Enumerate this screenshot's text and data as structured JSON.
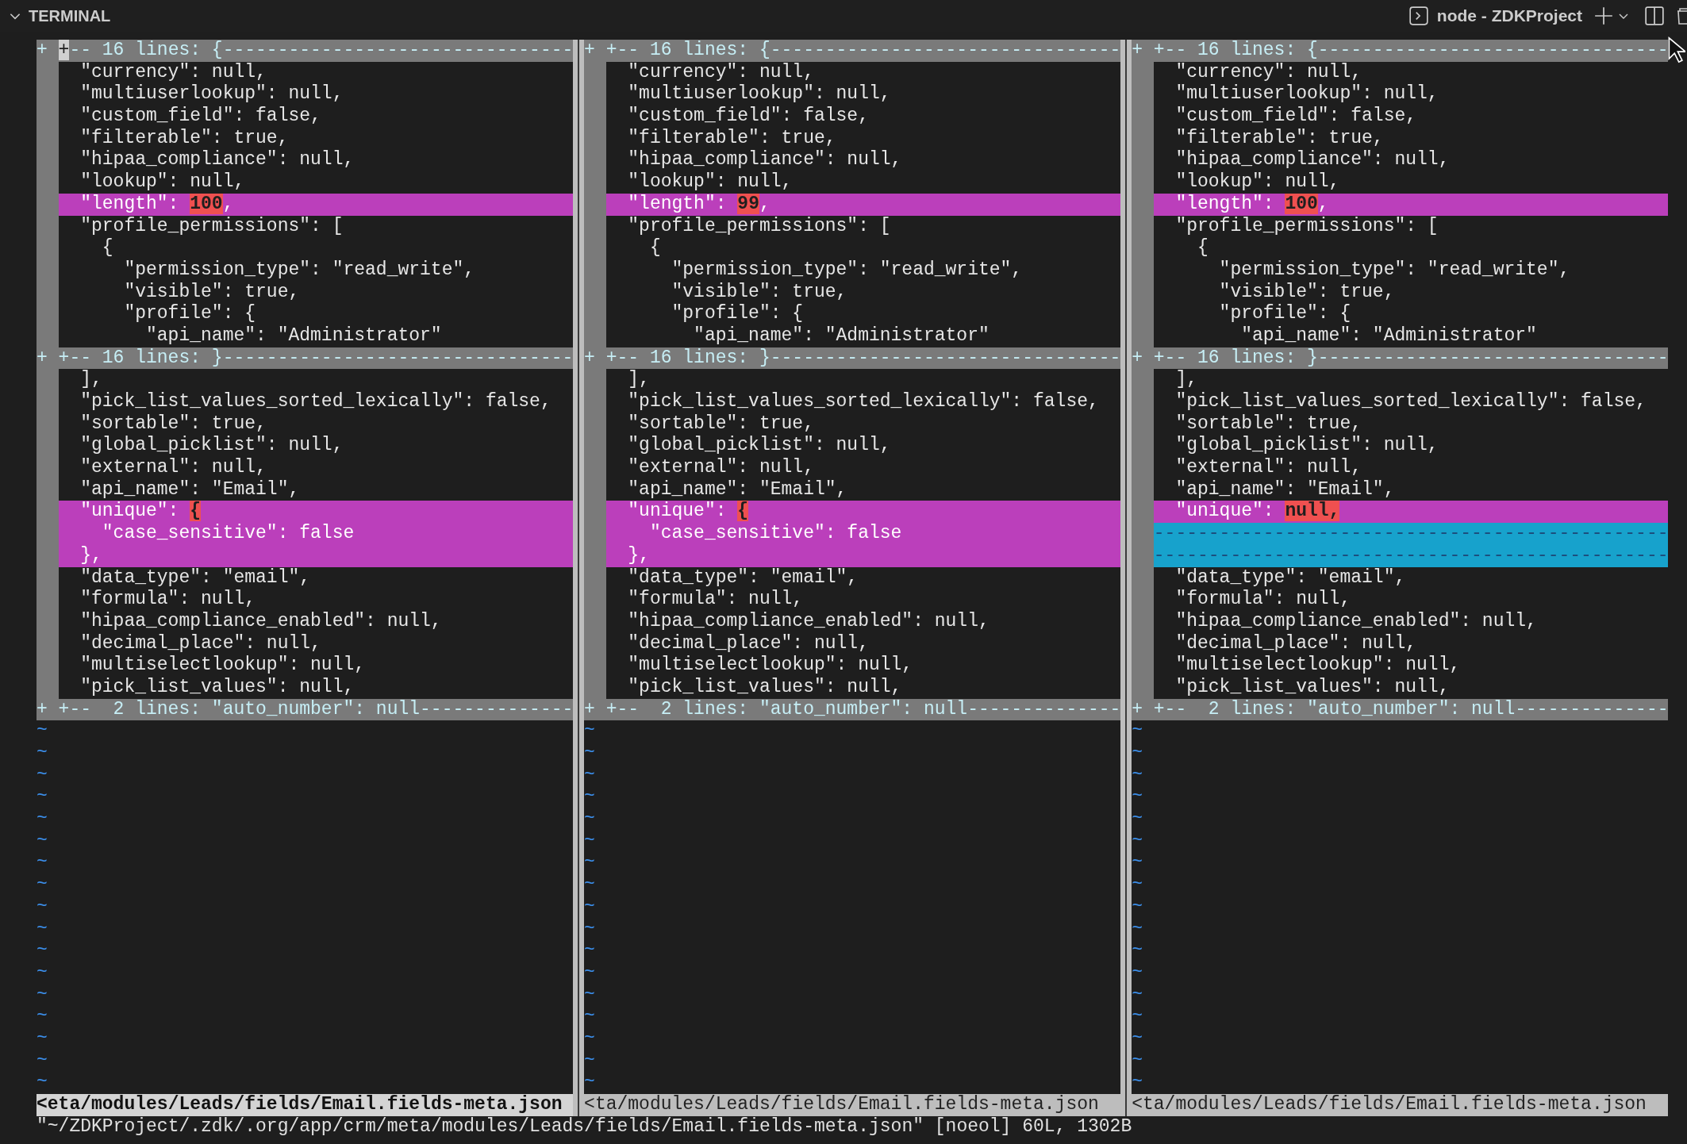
{
  "panel": {
    "title": "TERMINAL",
    "terminal_name": "node - ZDKProject"
  },
  "panes": [
    {
      "current": true,
      "status": "<eta/modules/Leads/fields/Email.fields-meta.json",
      "lines": [
        {
          "kind": "fold",
          "marker": "+",
          "text": "+-- 16 lines: {--------------------------------",
          "cursor": true
        },
        {
          "kind": "text",
          "text": "  \"currency\": null,"
        },
        {
          "kind": "text",
          "text": "  \"multiuserlookup\": null,"
        },
        {
          "kind": "text",
          "text": "  \"custom_field\": false,"
        },
        {
          "kind": "text",
          "text": "  \"filterable\": true,"
        },
        {
          "kind": "text",
          "text": "  \"hipaa_compliance\": null,"
        },
        {
          "kind": "text",
          "text": "  \"lookup\": null,"
        },
        {
          "kind": "changed",
          "text": "  \"length\": ",
          "highlight": "100",
          "after": ","
        },
        {
          "kind": "text",
          "text": "  \"profile_permissions\": ["
        },
        {
          "kind": "text",
          "text": "    {"
        },
        {
          "kind": "text",
          "text": "      \"permission_type\": \"read_write\","
        },
        {
          "kind": "text",
          "text": "      \"visible\": true,"
        },
        {
          "kind": "text",
          "text": "      \"profile\": {"
        },
        {
          "kind": "text",
          "text": "        \"api_name\": \"Administrator\""
        },
        {
          "kind": "fold",
          "marker": "+",
          "text": "+-- 16 lines: }--------------------------------"
        },
        {
          "kind": "text",
          "text": "  ],"
        },
        {
          "kind": "text",
          "text": "  \"pick_list_values_sorted_lexically\": false,"
        },
        {
          "kind": "text",
          "text": "  \"sortable\": true,"
        },
        {
          "kind": "text",
          "text": "  \"global_picklist\": null,"
        },
        {
          "kind": "text",
          "text": "  \"external\": null,"
        },
        {
          "kind": "text",
          "text": "  \"api_name\": \"Email\","
        },
        {
          "kind": "changed",
          "text": "  \"unique\": ",
          "highlight": "{"
        },
        {
          "kind": "changed",
          "text": "    \"case_sensitive\": false"
        },
        {
          "kind": "changed",
          "text": "  },"
        },
        {
          "kind": "text",
          "text": "  \"data_type\": \"email\","
        },
        {
          "kind": "text",
          "text": "  \"formula\": null,"
        },
        {
          "kind": "text",
          "text": "  \"hipaa_compliance_enabled\": null,"
        },
        {
          "kind": "text",
          "text": "  \"decimal_place\": null,"
        },
        {
          "kind": "text",
          "text": "  \"multiselectlookup\": null,"
        },
        {
          "kind": "text",
          "text": "  \"pick_list_values\": null,"
        },
        {
          "kind": "fold",
          "marker": "+",
          "text": "+--  2 lines: \"auto_number\": null--------------"
        },
        {
          "kind": "tilde",
          "text": "~"
        },
        {
          "kind": "tilde",
          "text": "~"
        },
        {
          "kind": "tilde",
          "text": "~"
        },
        {
          "kind": "tilde",
          "text": "~"
        },
        {
          "kind": "tilde",
          "text": "~"
        },
        {
          "kind": "tilde",
          "text": "~"
        },
        {
          "kind": "tilde",
          "text": "~"
        },
        {
          "kind": "tilde",
          "text": "~"
        },
        {
          "kind": "tilde",
          "text": "~"
        },
        {
          "kind": "tilde",
          "text": "~"
        },
        {
          "kind": "tilde",
          "text": "~"
        },
        {
          "kind": "tilde",
          "text": "~"
        },
        {
          "kind": "tilde",
          "text": "~"
        },
        {
          "kind": "tilde",
          "text": "~"
        },
        {
          "kind": "tilde",
          "text": "~"
        },
        {
          "kind": "tilde",
          "text": "~"
        },
        {
          "kind": "tilde",
          "text": "~"
        }
      ]
    },
    {
      "current": false,
      "status": "<ta/modules/Leads/fields/Email.fields-meta.json",
      "lines": [
        {
          "kind": "fold",
          "marker": "+",
          "text": "+-- 16 lines: {--------------------------------"
        },
        {
          "kind": "text",
          "text": "  \"currency\": null,"
        },
        {
          "kind": "text",
          "text": "  \"multiuserlookup\": null,"
        },
        {
          "kind": "text",
          "text": "  \"custom_field\": false,"
        },
        {
          "kind": "text",
          "text": "  \"filterable\": true,"
        },
        {
          "kind": "text",
          "text": "  \"hipaa_compliance\": null,"
        },
        {
          "kind": "text",
          "text": "  \"lookup\": null,"
        },
        {
          "kind": "changed",
          "text": "  \"length\": ",
          "highlight": "99",
          "after": ","
        },
        {
          "kind": "text",
          "text": "  \"profile_permissions\": ["
        },
        {
          "kind": "text",
          "text": "    {"
        },
        {
          "kind": "text",
          "text": "      \"permission_type\": \"read_write\","
        },
        {
          "kind": "text",
          "text": "      \"visible\": true,"
        },
        {
          "kind": "text",
          "text": "      \"profile\": {"
        },
        {
          "kind": "text",
          "text": "        \"api_name\": \"Administrator\""
        },
        {
          "kind": "fold",
          "marker": "+",
          "text": "+-- 16 lines: }--------------------------------"
        },
        {
          "kind": "text",
          "text": "  ],"
        },
        {
          "kind": "text",
          "text": "  \"pick_list_values_sorted_lexically\": false,"
        },
        {
          "kind": "text",
          "text": "  \"sortable\": true,"
        },
        {
          "kind": "text",
          "text": "  \"global_picklist\": null,"
        },
        {
          "kind": "text",
          "text": "  \"external\": null,"
        },
        {
          "kind": "text",
          "text": "  \"api_name\": \"Email\","
        },
        {
          "kind": "changed",
          "text": "  \"unique\": ",
          "highlight": "{"
        },
        {
          "kind": "changed",
          "text": "    \"case_sensitive\": false"
        },
        {
          "kind": "changed",
          "text": "  },"
        },
        {
          "kind": "text",
          "text": "  \"data_type\": \"email\","
        },
        {
          "kind": "text",
          "text": "  \"formula\": null,"
        },
        {
          "kind": "text",
          "text": "  \"hipaa_compliance_enabled\": null,"
        },
        {
          "kind": "text",
          "text": "  \"decimal_place\": null,"
        },
        {
          "kind": "text",
          "text": "  \"multiselectlookup\": null,"
        },
        {
          "kind": "text",
          "text": "  \"pick_list_values\": null,"
        },
        {
          "kind": "fold",
          "marker": "+",
          "text": "+--  2 lines: \"auto_number\": null--------------"
        },
        {
          "kind": "tilde",
          "text": "~"
        },
        {
          "kind": "tilde",
          "text": "~"
        },
        {
          "kind": "tilde",
          "text": "~"
        },
        {
          "kind": "tilde",
          "text": "~"
        },
        {
          "kind": "tilde",
          "text": "~"
        },
        {
          "kind": "tilde",
          "text": "~"
        },
        {
          "kind": "tilde",
          "text": "~"
        },
        {
          "kind": "tilde",
          "text": "~"
        },
        {
          "kind": "tilde",
          "text": "~"
        },
        {
          "kind": "tilde",
          "text": "~"
        },
        {
          "kind": "tilde",
          "text": "~"
        },
        {
          "kind": "tilde",
          "text": "~"
        },
        {
          "kind": "tilde",
          "text": "~"
        },
        {
          "kind": "tilde",
          "text": "~"
        },
        {
          "kind": "tilde",
          "text": "~"
        },
        {
          "kind": "tilde",
          "text": "~"
        },
        {
          "kind": "tilde",
          "text": "~"
        }
      ]
    },
    {
      "current": false,
      "status": "<ta/modules/Leads/fields/Email.fields-meta.json",
      "lines": [
        {
          "kind": "fold",
          "marker": "+",
          "text": "+-- 16 lines: {--------------------------------"
        },
        {
          "kind": "text",
          "text": "  \"currency\": null,"
        },
        {
          "kind": "text",
          "text": "  \"multiuserlookup\": null,"
        },
        {
          "kind": "text",
          "text": "  \"custom_field\": false,"
        },
        {
          "kind": "text",
          "text": "  \"filterable\": true,"
        },
        {
          "kind": "text",
          "text": "  \"hipaa_compliance\": null,"
        },
        {
          "kind": "text",
          "text": "  \"lookup\": null,"
        },
        {
          "kind": "changed",
          "text": "  \"length\": ",
          "highlight": "100",
          "after": ","
        },
        {
          "kind": "text",
          "text": "  \"profile_permissions\": ["
        },
        {
          "kind": "text",
          "text": "    {"
        },
        {
          "kind": "text",
          "text": "      \"permission_type\": \"read_write\","
        },
        {
          "kind": "text",
          "text": "      \"visible\": true,"
        },
        {
          "kind": "text",
          "text": "      \"profile\": {"
        },
        {
          "kind": "text",
          "text": "        \"api_name\": \"Administrator\""
        },
        {
          "kind": "fold",
          "marker": "+",
          "text": "+-- 16 lines: }--------------------------------"
        },
        {
          "kind": "text",
          "text": "  ],"
        },
        {
          "kind": "text",
          "text": "  \"pick_list_values_sorted_lexically\": false,"
        },
        {
          "kind": "text",
          "text": "  \"sortable\": true,"
        },
        {
          "kind": "text",
          "text": "  \"global_picklist\": null,"
        },
        {
          "kind": "text",
          "text": "  \"external\": null,"
        },
        {
          "kind": "text",
          "text": "  \"api_name\": \"Email\","
        },
        {
          "kind": "changed",
          "text": "  \"unique\": ",
          "highlight": "null,"
        },
        {
          "kind": "filler",
          "text": "-----------------------------------------------"
        },
        {
          "kind": "filler",
          "text": "-----------------------------------------------"
        },
        {
          "kind": "text",
          "text": "  \"data_type\": \"email\","
        },
        {
          "kind": "text",
          "text": "  \"formula\": null,"
        },
        {
          "kind": "text",
          "text": "  \"hipaa_compliance_enabled\": null,"
        },
        {
          "kind": "text",
          "text": "  \"decimal_place\": null,"
        },
        {
          "kind": "text",
          "text": "  \"multiselectlookup\": null,"
        },
        {
          "kind": "text",
          "text": "  \"pick_list_values\": null,"
        },
        {
          "kind": "fold",
          "marker": "+",
          "text": "+--  2 lines: \"auto_number\": null--------------"
        },
        {
          "kind": "tilde",
          "text": "~"
        },
        {
          "kind": "tilde",
          "text": "~"
        },
        {
          "kind": "tilde",
          "text": "~"
        },
        {
          "kind": "tilde",
          "text": "~"
        },
        {
          "kind": "tilde",
          "text": "~"
        },
        {
          "kind": "tilde",
          "text": "~"
        },
        {
          "kind": "tilde",
          "text": "~"
        },
        {
          "kind": "tilde",
          "text": "~"
        },
        {
          "kind": "tilde",
          "text": "~"
        },
        {
          "kind": "tilde",
          "text": "~"
        },
        {
          "kind": "tilde",
          "text": "~"
        },
        {
          "kind": "tilde",
          "text": "~"
        },
        {
          "kind": "tilde",
          "text": "~"
        },
        {
          "kind": "tilde",
          "text": "~"
        },
        {
          "kind": "tilde",
          "text": "~"
        },
        {
          "kind": "tilde",
          "text": "~"
        },
        {
          "kind": "tilde",
          "text": "~"
        }
      ]
    }
  ],
  "command_line": "\"~/ZDKProject/.zdk/.org/app/crm/meta/modules/Leads/fields/Email.fields-meta.json\" [noeol] 60L, 1302B"
}
